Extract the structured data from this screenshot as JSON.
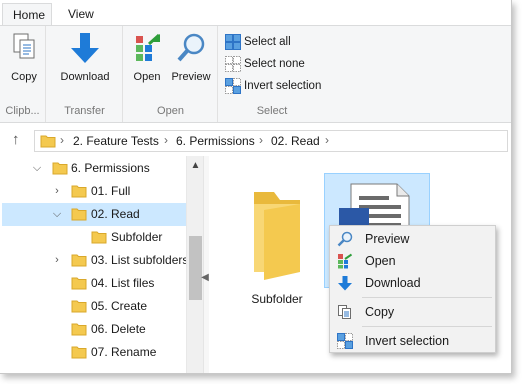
{
  "ribbon": {
    "tabs": [
      {
        "label": "Home",
        "active": true
      },
      {
        "label": "View",
        "active": false
      }
    ],
    "groups": {
      "clipboard": {
        "label": "Clipb...",
        "copy": "Copy"
      },
      "transfer": {
        "label": "Transfer",
        "download": "Download"
      },
      "open": {
        "label": "Open",
        "open": "Open",
        "preview": "Preview"
      },
      "select": {
        "label": "Select",
        "select_all": "Select all",
        "select_none": "Select none",
        "invert": "Invert selection"
      }
    }
  },
  "address": {
    "crumbs": [
      "2. Feature Tests",
      "6. Permissions",
      "02. Read"
    ]
  },
  "tree": [
    {
      "label": "6. Permissions",
      "expanded": true
    },
    {
      "label": "01. Full",
      "expanded": false
    },
    {
      "label": "02. Read",
      "expanded": true,
      "selected": true
    },
    {
      "label": "Subfolder"
    },
    {
      "label": "03. List subfolders",
      "expanded": false
    },
    {
      "label": "04. List files"
    },
    {
      "label": "05. Create"
    },
    {
      "label": "06. Delete"
    },
    {
      "label": "07. Rename"
    }
  ],
  "content": {
    "items": [
      {
        "label": "Subfolder",
        "icon": "folder-icon"
      },
      {
        "label": "",
        "icon": "document-icon",
        "selected": true
      }
    ]
  },
  "context_menu": {
    "items": [
      {
        "label": "Preview",
        "icon": "magnifier-icon"
      },
      {
        "label": "Open",
        "icon": "open-icon"
      },
      {
        "label": "Download",
        "icon": "download-icon"
      },
      {
        "label": "Copy",
        "icon": "copy-icon"
      },
      {
        "label": "Invert selection",
        "icon": "invert-selection-icon"
      }
    ]
  },
  "colors": {
    "accent": "#1e7bd8",
    "selection": "#cce8ff",
    "folder": "#f4c94f",
    "ribbon_bg": "#f5f6f7"
  }
}
